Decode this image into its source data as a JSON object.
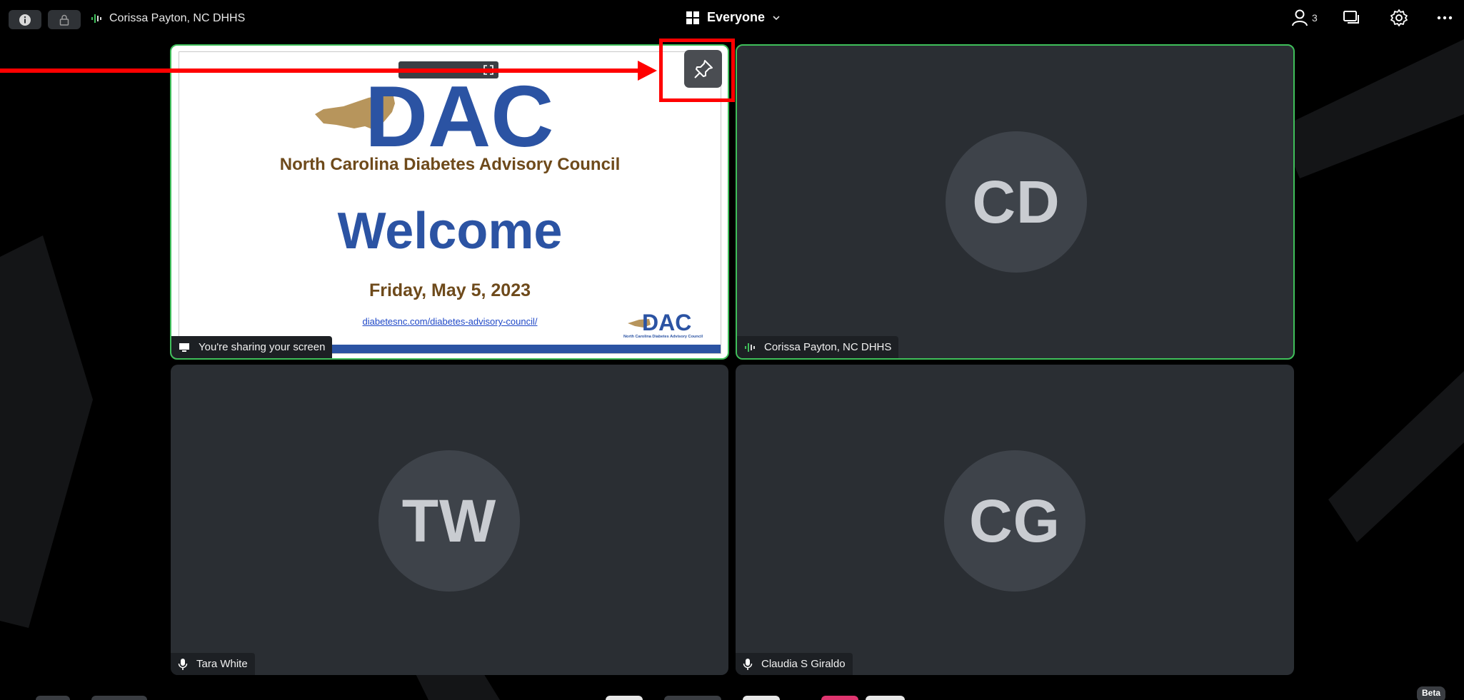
{
  "topbar": {
    "active_speaker": "Corissa Payton, NC DHHS",
    "view_label": "Everyone",
    "participant_count": "3"
  },
  "tiles": {
    "screen_share": {
      "name_tag": "You're sharing your screen"
    },
    "corissa": {
      "initials": "CD",
      "name_tag": "Corissa Payton, NC DHHS"
    },
    "tara": {
      "initials": "TW",
      "name_tag": "Tara White"
    },
    "claudia": {
      "initials": "CG",
      "name_tag": "Claudia S Giraldo"
    }
  },
  "slide": {
    "logo_text": "DAC",
    "council_name": "North Carolina Diabetes Advisory Council",
    "title": "Welcome",
    "date": "Friday, May 5, 2023",
    "link": "diabetesnc.com/diabetes-advisory-council/",
    "mini_logo_text": "DAC",
    "mini_logo_caption": "North Carolina Diabetes Advisory Council"
  },
  "footer": {
    "beta_label": "Beta"
  },
  "colors": {
    "active_border": "#3fbf5a",
    "annotation_red": "#ff0000",
    "slide_blue": "#2b53a3",
    "slide_brown": "#6e4a1b",
    "tile_bg": "#2a2e33"
  },
  "icons": {
    "info": "info-icon",
    "lock": "lock-icon",
    "audio": "audio-wave-icon",
    "grid": "grid-icon",
    "chevron": "chevron-down-icon",
    "participants": "person-icon",
    "chat": "chat-icon",
    "settings": "gear-icon",
    "more": "more-icon",
    "pin": "pin-icon",
    "fullscreen": "fullscreen-icon",
    "screen": "screen-share-icon",
    "mic": "microphone-icon"
  }
}
